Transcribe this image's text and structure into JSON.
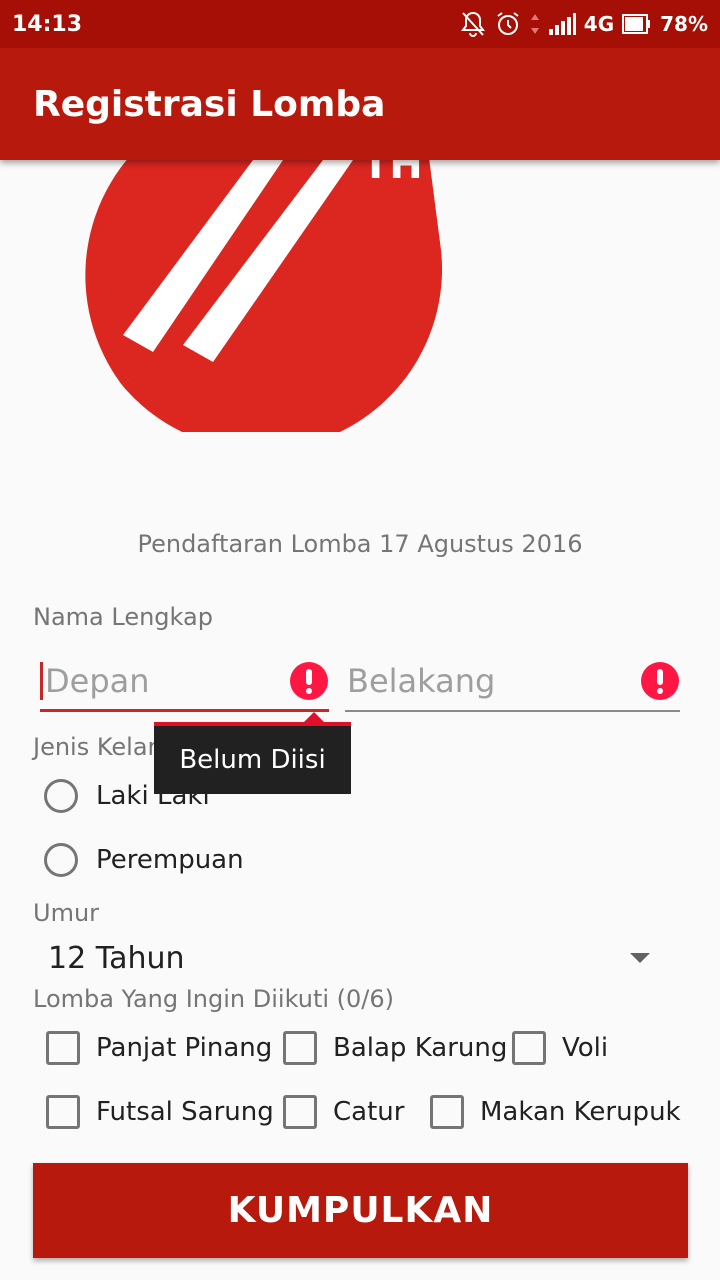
{
  "status_bar": {
    "time": "14:13",
    "network": "4G",
    "battery": "78%",
    "icons": [
      "mute-icon",
      "alarm-icon",
      "signal-icon",
      "battery-icon"
    ]
  },
  "app_bar": {
    "title": "Registrasi Lomba"
  },
  "logo": {
    "text": "TH",
    "colors": {
      "circle": "#dc2620",
      "stripes": "#ffffff"
    }
  },
  "subtitle": "Pendaftaran Lomba 17 Agustus 2016",
  "name_section": {
    "label": "Nama Lengkap",
    "first_name": {
      "placeholder": "Depan",
      "value": ""
    },
    "last_name": {
      "placeholder": "Belakang",
      "value": ""
    },
    "error_tooltip": "Belum Diisi"
  },
  "gender_section": {
    "label": "Jenis Kelamin",
    "options": [
      "Laki Laki",
      "Perempuan"
    ]
  },
  "age_section": {
    "label": "Umur",
    "selected": "12 Tahun"
  },
  "competition_section": {
    "label": "Lomba Yang Ingin Diikuti (0/6)",
    "options": [
      "Panjat Pinang",
      "Balap Karung",
      "Voli",
      "Futsal Sarung",
      "Catur",
      "Makan Kerupuk"
    ]
  },
  "submit_label": "KUMPULKAN",
  "colors": {
    "primary": "#b8190d",
    "primary_dark": "#a50f05",
    "error": "#ff1744"
  }
}
